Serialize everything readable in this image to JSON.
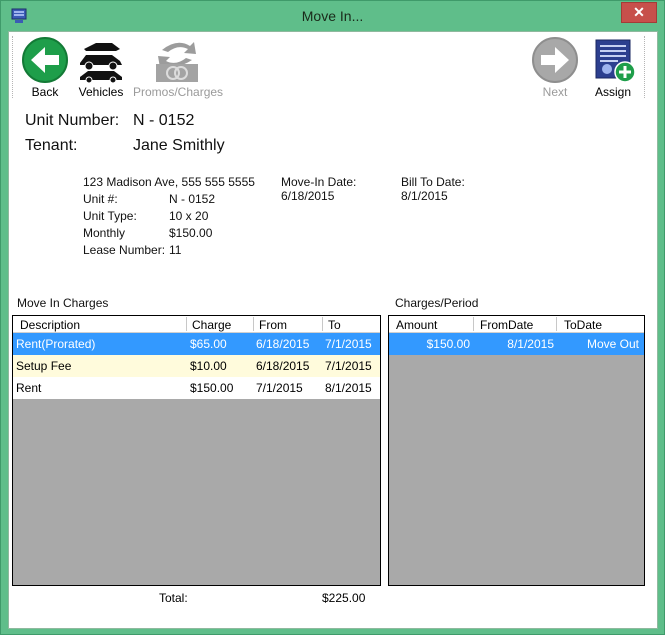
{
  "window": {
    "title": "Move In..."
  },
  "toolbar": {
    "back_label": "Back",
    "vehicles_label": "Vehicles",
    "promos_label": "Promos/Charges",
    "next_label": "Next",
    "assign_label": "Assign"
  },
  "header": {
    "unit_number_label": "Unit Number:",
    "unit_number_value": "N - 0152",
    "tenant_label": "Tenant:",
    "tenant_value": "Jane Smithly"
  },
  "details": {
    "address": "123 Madison Ave, 555 555 5555",
    "unit_label": "Unit #:",
    "unit_value": "N - 0152",
    "unit_type_label": "Unit Type:",
    "unit_type_value": "10 x 20",
    "monthly_label": "Monthly",
    "monthly_value": "$150.00",
    "lease_label": "Lease Number:",
    "lease_value": "11",
    "move_in_label": "Move-In Date:",
    "move_in_value": "6/18/2015",
    "bill_to_label": "Bill To Date:",
    "bill_to_value": "8/1/2015"
  },
  "charges": {
    "title": "Move In Charges",
    "columns": [
      "Description",
      "Charge",
      "From",
      "To"
    ],
    "rows": [
      {
        "description": "Rent(Prorated)",
        "charge": "$65.00",
        "from": "6/18/2015",
        "to": "7/1/2015"
      },
      {
        "description": "Setup Fee",
        "charge": "$10.00",
        "from": "6/18/2015",
        "to": "7/1/2015"
      },
      {
        "description": "Rent",
        "charge": "$150.00",
        "from": "7/1/2015",
        "to": "8/1/2015"
      }
    ],
    "total_label": "Total:",
    "total_value": "$225.00"
  },
  "period": {
    "title": "Charges/Period",
    "columns": [
      "Amount",
      "FromDate",
      "ToDate"
    ],
    "rows": [
      {
        "amount": "$150.00",
        "from": "8/1/2015",
        "to": "Move Out"
      }
    ]
  },
  "colors": {
    "titlebar": "#5fbe8a",
    "selection": "#3399ff",
    "alt_row": "#fffbdc",
    "grid_empty": "#a9a9a9",
    "back_button": "#1e9e4a"
  }
}
